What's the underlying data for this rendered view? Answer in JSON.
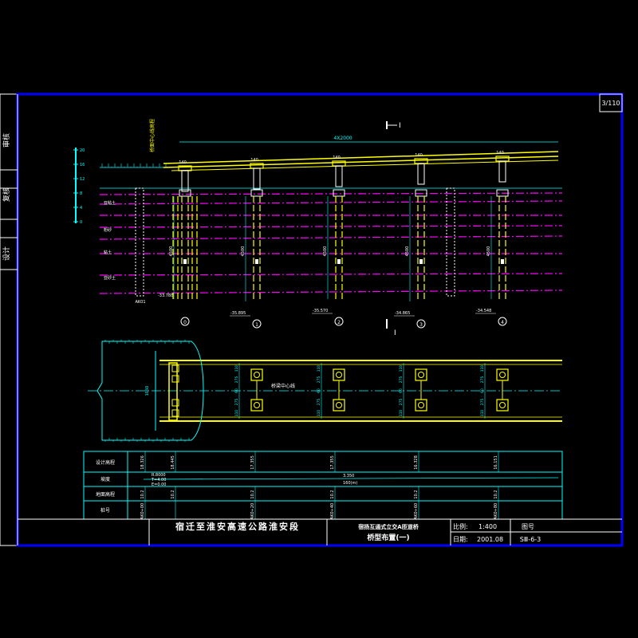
{
  "sheet": {
    "number": "3/110",
    "project": "宿迁至淮安高速公路淮安段",
    "subtitle": "宿扬互通式立交A匝道桥",
    "title": "桥型布置(一)",
    "scale_label": "比例:",
    "scale_value": "1:400",
    "date_label": "日期:",
    "date_value": "2001.08",
    "drawing_no_label": "图号",
    "drawing_no": "SⅢ-6-3"
  },
  "side_labels": [
    "审核",
    "复核",
    "设计"
  ],
  "elevation": {
    "span_total": "4X2000",
    "section_mark": "Ⅰ",
    "pier_numbers": [
      "⓪",
      "①",
      "②",
      "③",
      "④"
    ],
    "bottom_elevations": [
      "-35.895",
      "-35.570",
      "-34.865",
      "-34.548"
    ],
    "hole_mark": "AK01",
    "hole_bottom": "-33.788",
    "pile_length": "4500",
    "cap_width": "140",
    "deck_note": "桥面中心线高程",
    "soil_layers": [
      "亚粘土",
      "粉砂",
      "粘土",
      "亚砂土"
    ],
    "scale_ticks": [
      "20",
      "16",
      "12",
      "8",
      "4",
      "0"
    ]
  },
  "plan": {
    "centerline_label": "桥梁中心线",
    "width": "1050",
    "dims": [
      "110",
      "275",
      "60",
      "275",
      "110"
    ]
  },
  "profile_table": {
    "row_labels": [
      "设计高程",
      "坡度",
      "地面高程",
      "桩号"
    ],
    "design_elev": [
      "18.326",
      "18.445",
      "17.355",
      "17.355",
      "16.328",
      "16.151"
    ],
    "slope_values": [
      "R.8000",
      "T=4.00",
      "E=0.00",
      "3.350",
      "160(m)"
    ],
    "ground_elev": [
      "10.2",
      "10.2",
      "10.2",
      "10.2",
      "10.2",
      "10.2"
    ],
    "stations": [
      "AK0+00",
      "AK0+20",
      "AK0+40",
      "AK0+60",
      "AK0+80"
    ]
  },
  "colors": {
    "border": "#0000ff",
    "line": "#00ffff",
    "highlight": "#ffff00",
    "magenta": "#ff00ff",
    "text": "#ffffff"
  }
}
